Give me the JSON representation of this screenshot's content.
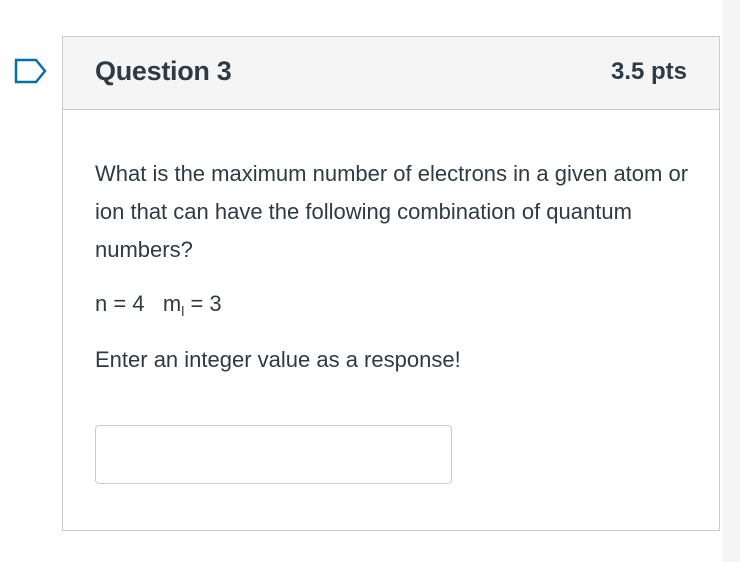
{
  "question": {
    "title": "Question 3",
    "points": "3.5 pts",
    "text": "What is the maximum number of electrons in a given atom or ion that can have the following combination of quantum numbers?",
    "numbers": {
      "n_part": "n = 4   m",
      "subscript": "l",
      "ml_part": " = 3"
    },
    "instruction": "Enter an integer value as a response!",
    "answer": {
      "value": "",
      "placeholder": ""
    }
  },
  "icons": {
    "flag": "flag-question-icon"
  },
  "colors": {
    "accent": "#0770a3",
    "text": "#2d3b45",
    "border": "#c7cdd1",
    "header_bg": "#f5f5f5"
  }
}
